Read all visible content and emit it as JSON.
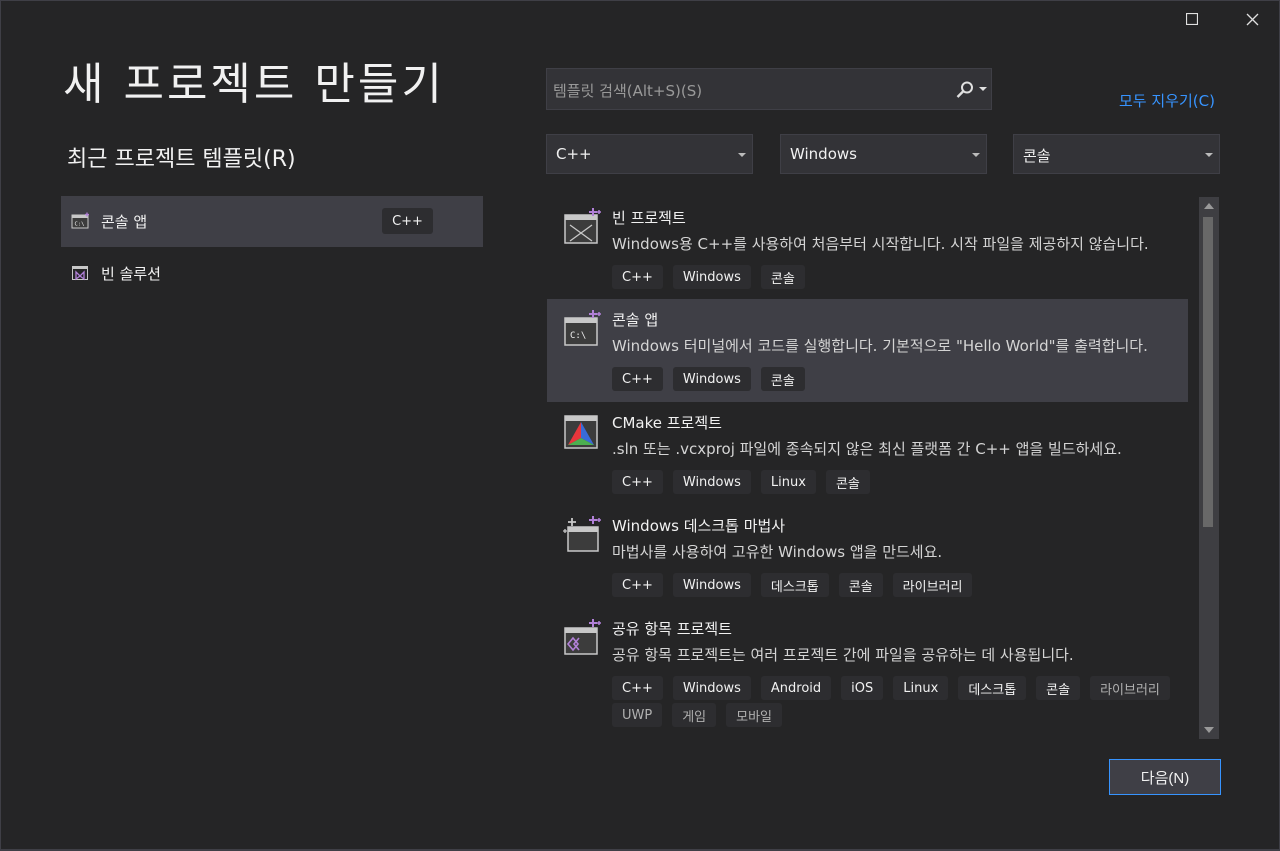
{
  "window": {
    "title": "새 프로젝트 만들기"
  },
  "recent": {
    "heading": "최근 프로젝트 템플릿(R)",
    "items": [
      {
        "label": "콘솔 앱",
        "tag": "C++",
        "icon": "console-app-icon",
        "selected": true
      },
      {
        "label": "빈 솔루션",
        "tag": "",
        "icon": "blank-solution-icon",
        "selected": false
      }
    ]
  },
  "search": {
    "placeholder": "템플릿 검색(Alt+S)(S)",
    "value": ""
  },
  "clear_all": "모두 지우기(C)",
  "filters": {
    "language": "C++",
    "platform": "Windows",
    "project_type": "콘솔"
  },
  "templates": [
    {
      "name": "빈 프로젝트",
      "description": "Windows용 C++를 사용하여 처음부터 시작합니다. 시작 파일을 제공하지 않습니다.",
      "tags": [
        "C++",
        "Windows",
        "콘솔"
      ],
      "icon": "empty-project-icon"
    },
    {
      "name": "콘솔 앱",
      "description": "Windows 터미널에서 코드를 실행합니다. 기본적으로 \"Hello World\"를 출력합니다.",
      "tags": [
        "C++",
        "Windows",
        "콘솔"
      ],
      "icon": "console-app-icon",
      "selected": true
    },
    {
      "name": "CMake 프로젝트",
      "description": ".sln 또는 .vcxproj 파일에 종속되지 않은 최신 플랫폼 간 C++ 앱을 빌드하세요.",
      "tags": [
        "C++",
        "Windows",
        "Linux",
        "콘솔"
      ],
      "icon": "cmake-icon"
    },
    {
      "name": "Windows 데스크톱 마법사",
      "description": "마법사를 사용하여 고유한 Windows 앱을 만드세요.",
      "tags": [
        "C++",
        "Windows",
        "데스크톱",
        "콘솔",
        "라이브러리"
      ],
      "icon": "desktop-wizard-icon"
    },
    {
      "name": "공유 항목 프로젝트",
      "description": "공유 항목 프로젝트는 여러 프로젝트 간에 파일을 공유하는 데 사용됩니다.",
      "tags": [
        "C++",
        "Windows",
        "Android",
        "iOS",
        "Linux",
        "데스크톱",
        "콘솔",
        "라이브러리",
        "UWP",
        "게임",
        "모바일"
      ],
      "icon": "shared-items-icon"
    }
  ],
  "buttons": {
    "next": "다음(N)"
  },
  "colors": {
    "background": "#252526",
    "accent": "#3794ff",
    "selected": "#3f3f46",
    "tag": "#2d2d30",
    "icon_purple": "#b180d7"
  }
}
